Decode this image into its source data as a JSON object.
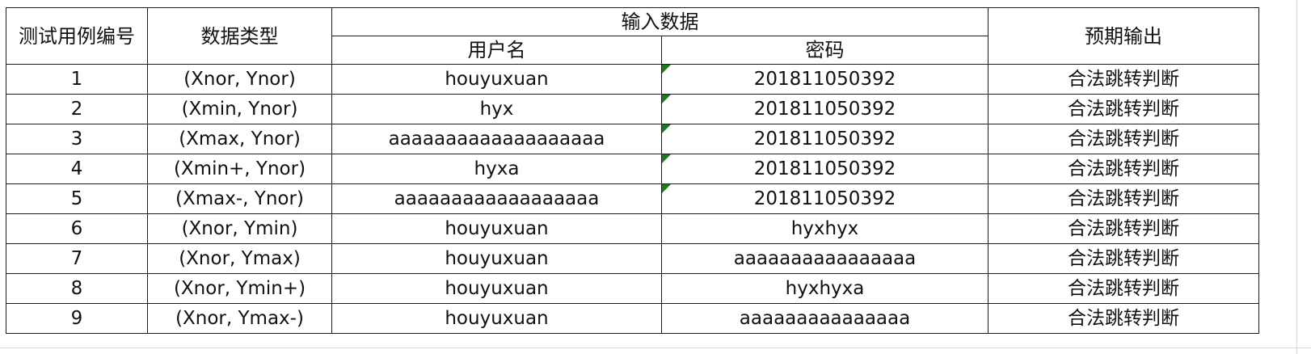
{
  "table": {
    "headers": {
      "case_id": "测试用例编号",
      "data_type": "数据类型",
      "input_data": "输入数据",
      "username": "用户名",
      "password": "密码",
      "expected": "预期输出"
    },
    "rows": [
      {
        "id": "1",
        "type": "(Xnor, Ynor)",
        "username": "houyuxuan",
        "password": "201811050392",
        "expected": "合法跳转判断",
        "password_marker": true
      },
      {
        "id": "2",
        "type": "(Xmin, Ynor)",
        "username": "hyx",
        "password": "201811050392",
        "expected": "合法跳转判断",
        "password_marker": true
      },
      {
        "id": "3",
        "type": "(Xmax, Ynor)",
        "username": "aaaaaaaaaaaaaaaaaaa",
        "password": "201811050392",
        "expected": "合法跳转判断",
        "password_marker": true
      },
      {
        "id": "4",
        "type": "(Xmin+, Ynor)",
        "username": "hyxa",
        "password": "201811050392",
        "expected": "合法跳转判断",
        "password_marker": true
      },
      {
        "id": "5",
        "type": "(Xmax-, Ynor)",
        "username": "aaaaaaaaaaaaaaaaaa",
        "password": "201811050392",
        "expected": "合法跳转判断",
        "password_marker": true
      },
      {
        "id": "6",
        "type": "(Xnor, Ymin)",
        "username": "houyuxuan",
        "password": "hyxhyx",
        "expected": "合法跳转判断",
        "password_marker": false
      },
      {
        "id": "7",
        "type": "(Xnor, Ymax)",
        "username": "houyuxuan",
        "password": "aaaaaaaaaaaaaaaa",
        "expected": "合法跳转判断",
        "password_marker": false
      },
      {
        "id": "8",
        "type": "(Xnor, Ymin+)",
        "username": "houyuxuan",
        "password": "hyxhyxa",
        "expected": "合法跳转判断",
        "password_marker": false
      },
      {
        "id": "9",
        "type": "(Xnor, Ymax-)",
        "username": "houyuxuan",
        "password": "aaaaaaaaaaaaaaa",
        "expected": "合法跳转判断",
        "password_marker": false
      }
    ]
  }
}
